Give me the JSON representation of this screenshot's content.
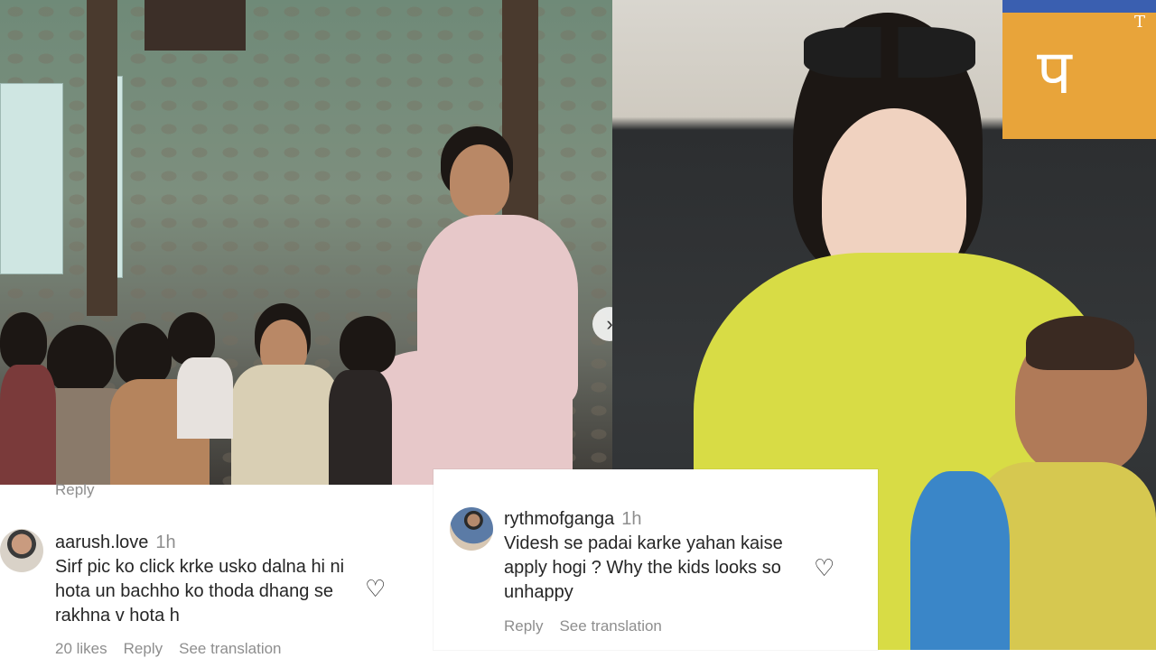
{
  "overlay": {
    "logo_text": "T"
  },
  "left_panel": {
    "top_reply": "Reply",
    "comment": {
      "username": "aarush.love",
      "time": "1h",
      "text": "Sirf pic ko click krke usko dalna hi ni hota un bachho ko thoda dhang se rakhna v hota h",
      "likes": "20 likes",
      "reply": "Reply",
      "see_translation": "See translation"
    }
  },
  "right_panel": {
    "comment": {
      "username": "rythmofganga",
      "time": "1h",
      "text": "Videsh se padai karke yahan kaise apply hogi ? Why the kids looks so unhappy",
      "reply": "Reply",
      "see_translation": "See translation"
    }
  },
  "icons": [
    "heart-icon",
    "chevron-right-icon"
  ]
}
